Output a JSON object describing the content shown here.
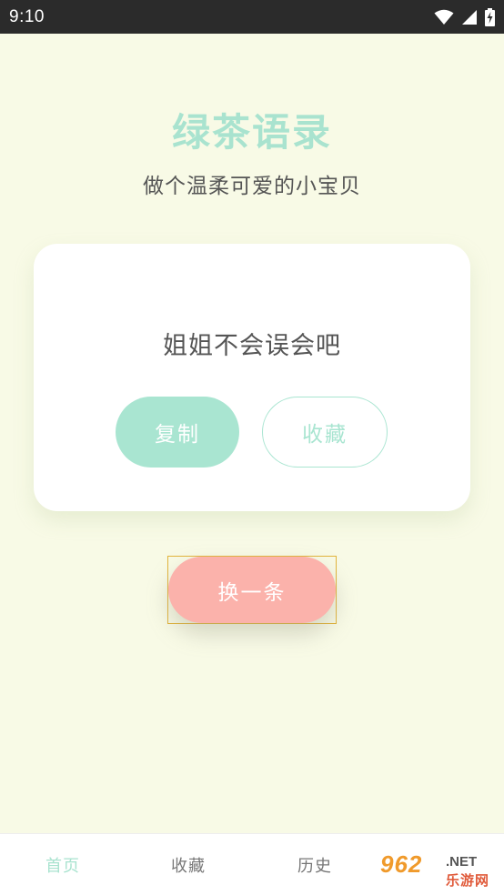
{
  "status_bar": {
    "time": "9:10",
    "icons": [
      "wifi-icon",
      "cellular-signal-icon",
      "battery-charging-icon"
    ]
  },
  "header": {
    "title": "绿茶语录",
    "subtitle": "做个温柔可爱的小宝贝"
  },
  "card": {
    "quote": "姐姐不会误会吧",
    "copy_label": "复制",
    "favorite_label": "收藏"
  },
  "next_label": "换一条",
  "bottom_nav": {
    "items": [
      {
        "label": "首页",
        "active": true
      },
      {
        "label": "收藏",
        "active": false
      },
      {
        "label": "历史",
        "active": false
      },
      {
        "label": "",
        "active": false
      }
    ]
  },
  "watermark": {
    "main": "962",
    "net": ".NET",
    "sub": "乐游网"
  },
  "colors": {
    "background": "#f8fae6",
    "accent_green": "#a9e3cf",
    "accent_pink": "#fbb2ab",
    "status_bar": "#2b2b2b"
  }
}
